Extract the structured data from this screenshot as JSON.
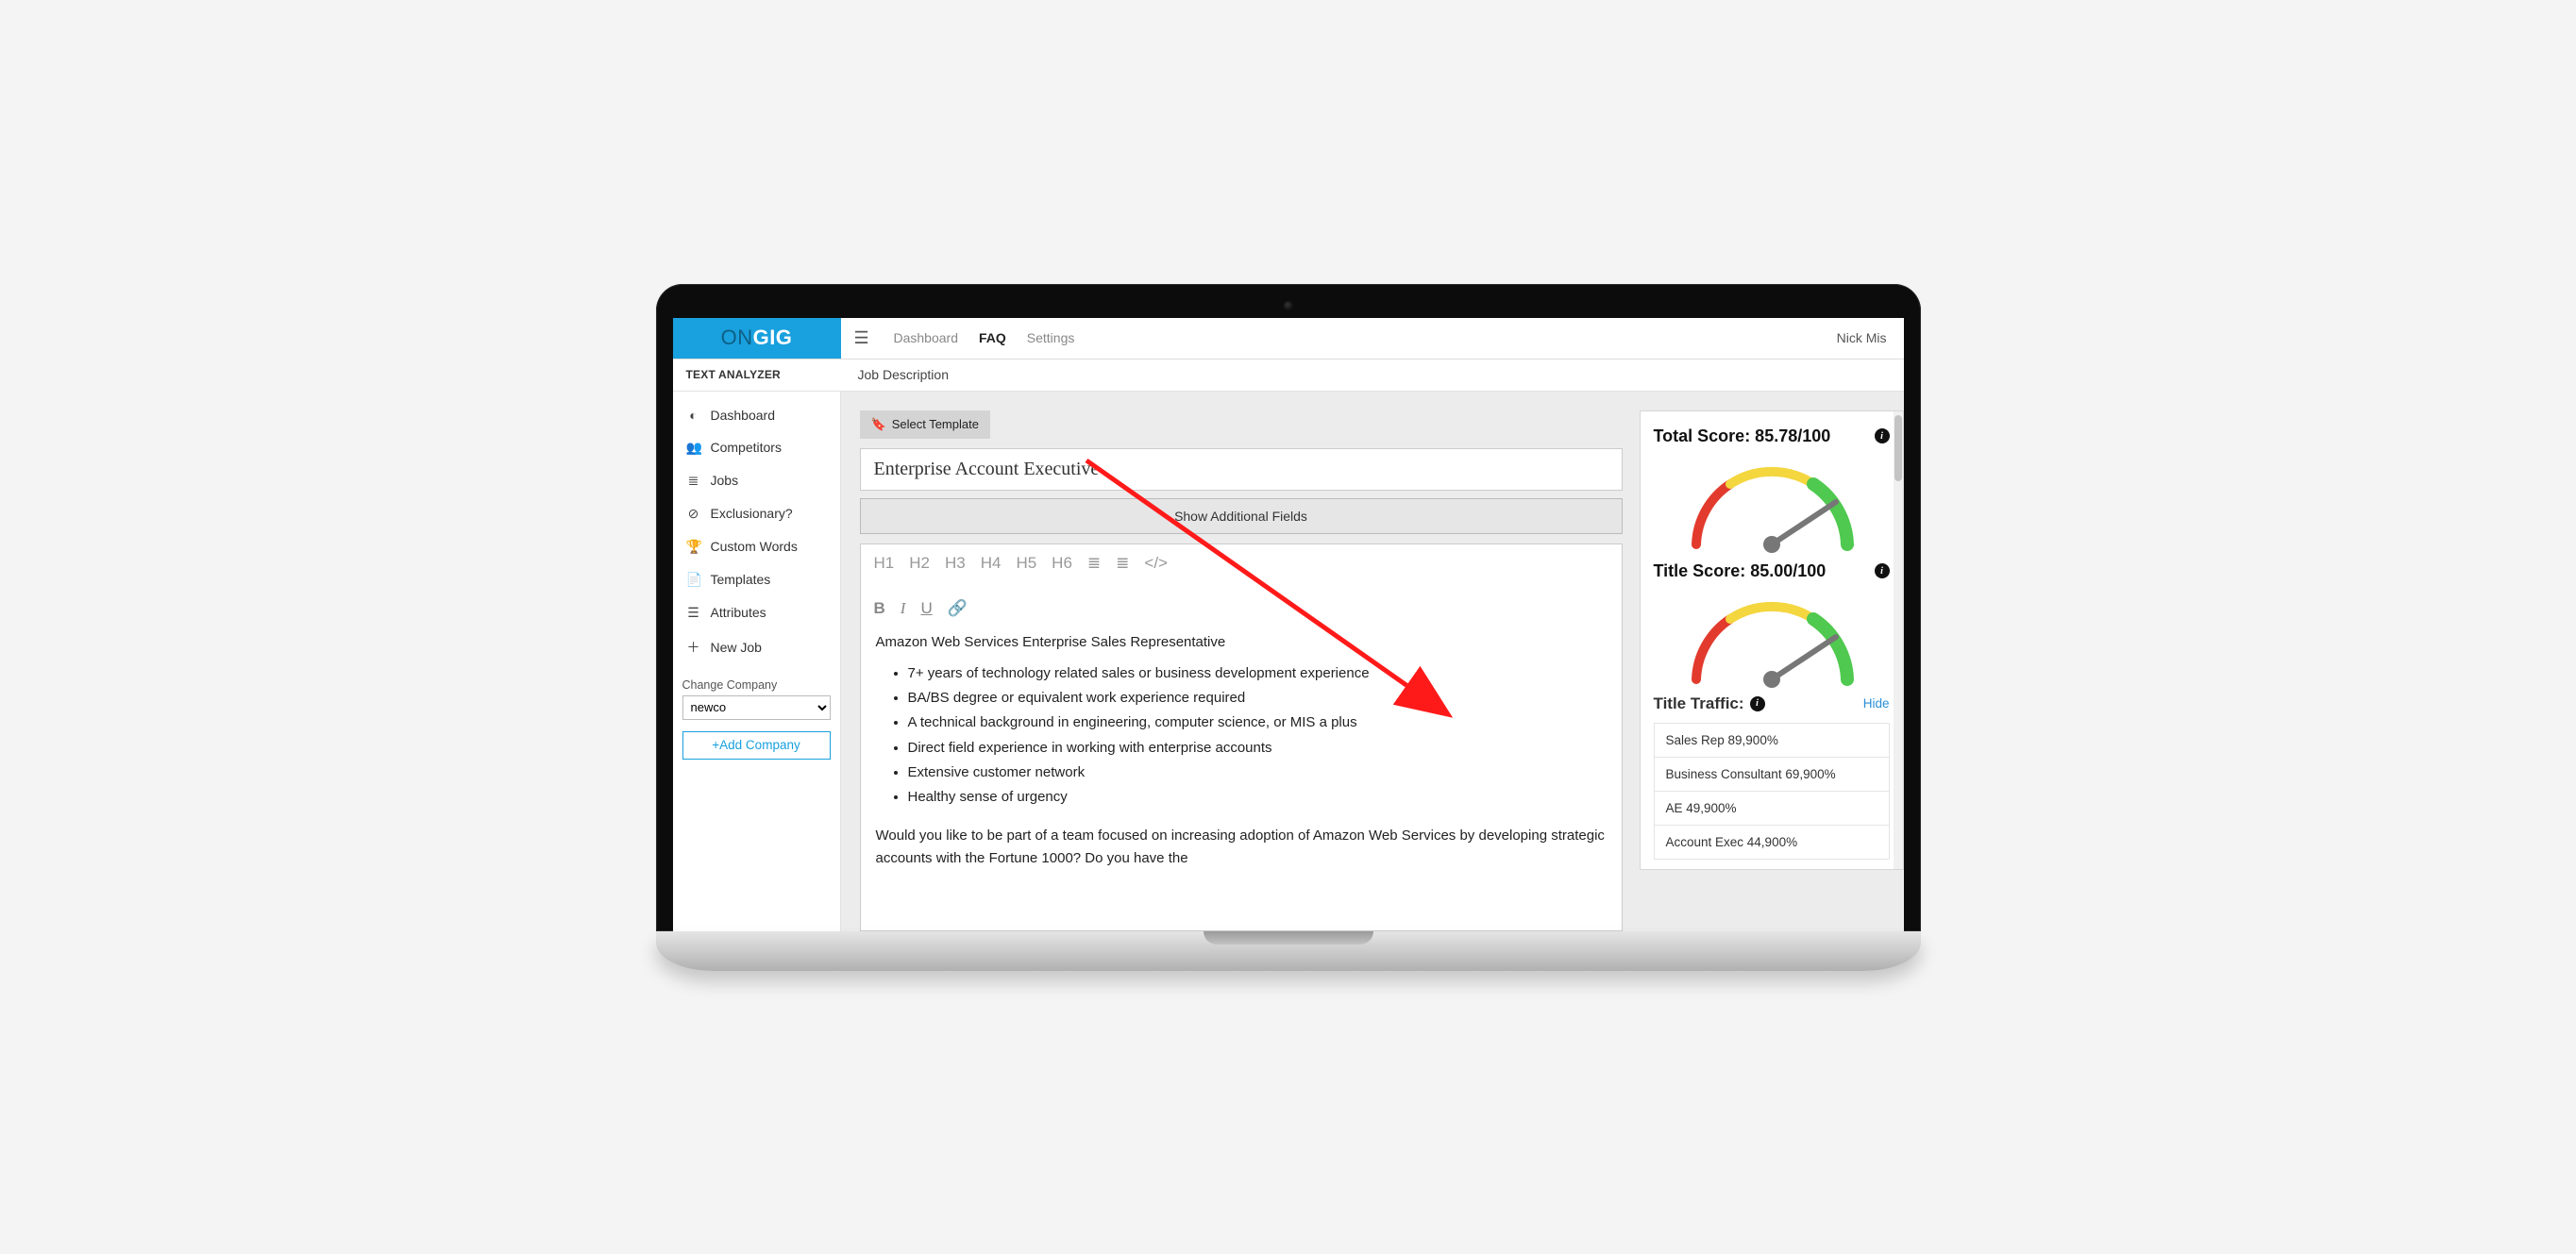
{
  "brand": {
    "part1": "ON",
    "part2": "GIG"
  },
  "topnav": {
    "dashboard": "Dashboard",
    "faq": "FAQ",
    "settings": "Settings",
    "user": "Nick Mis"
  },
  "subheader": {
    "section": "TEXT ANALYZER",
    "crumb": "Job Description"
  },
  "sidebar": {
    "items": [
      {
        "icon": "◐",
        "label": "Dashboard"
      },
      {
        "icon": "👥",
        "label": "Competitors"
      },
      {
        "icon": "≣",
        "label": "Jobs"
      },
      {
        "icon": "⊘",
        "label": "Exclusionary?"
      },
      {
        "icon": "🏆",
        "label": "Custom Words"
      },
      {
        "icon": "📄",
        "label": "Templates"
      },
      {
        "icon": "☰",
        "label": "Attributes"
      },
      {
        "icon": "＋",
        "label": "New Job"
      }
    ],
    "change_company_label": "Change Company",
    "company_value": "newco",
    "add_company": "+Add Company"
  },
  "editor": {
    "select_template": "Select Template",
    "title": "Enterprise Account Executive",
    "show_fields": "Show Additional Fields",
    "toolbar": {
      "h1": "H1",
      "h2": "H2",
      "h3": "H3",
      "h4": "H4",
      "h5": "H5",
      "h6": "H6",
      "ul": "≣",
      "ol": "≣",
      "code": "</>",
      "bold": "B",
      "italic": "I",
      "underline": "U",
      "link": "🔗"
    },
    "para1": "Amazon Web Services Enterprise Sales Representative",
    "bullets": [
      "7+ years of technology related sales or business development experience",
      "BA/BS degree or equivalent work experience required",
      "A technical background in engineering, computer science, or MIS a plus",
      "Direct field experience in working with enterprise accounts",
      "Extensive customer network",
      "Healthy sense of urgency"
    ],
    "para2": "Would you like to be part of a team focused on increasing adoption of Amazon Web Services by developing strategic accounts with the Fortune 1000? Do you have the"
  },
  "scores": {
    "total_label": "Total Score: 85.78/100",
    "title_label": "Title Score: 85.00/100",
    "traffic_label": "Title Traffic:",
    "hide": "Hide",
    "traffic": [
      "Sales Rep 89,900%",
      "Business Consultant 69,900%",
      "AE 49,900%",
      "Account Exec 44,900%"
    ]
  }
}
